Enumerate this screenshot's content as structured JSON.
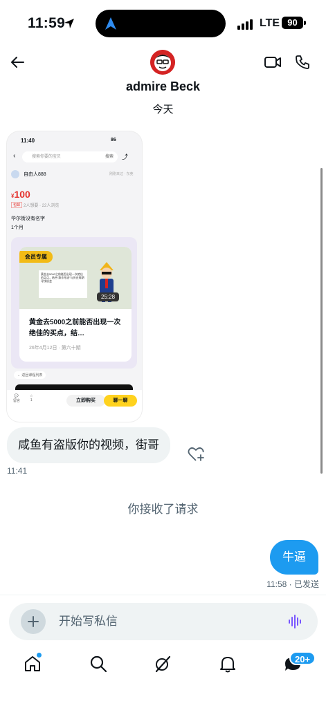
{
  "status_bar": {
    "time": "11:59",
    "network": "LTE",
    "battery": "90"
  },
  "header": {
    "contact_name": "admire Beck",
    "date_separator": "今天"
  },
  "shared_screenshot": {
    "status_time": "11:40",
    "status_battery": "86",
    "search_placeholder": "搜索你要的宝贝",
    "search_button": "搜索",
    "seller_name": "自由人888",
    "seller_right": "刚刚来过 · 东莞",
    "price_symbol": "¥",
    "price": "100",
    "tag": "包邮",
    "stats": "2人想要 · 22人浏览",
    "desc_line1": "华尔街没有名字",
    "desc_line2": "1个月",
    "badge": "会员专属",
    "poster_text": "黄金去5000之前能否出现一次绝佳的买点，结合“欺诈形态”与历史周期寻找机会",
    "duration": "25:28",
    "course_title": "黄金去5000之前能否出现一次绝佳的买点，结…",
    "course_meta": "26年4月12日 · 第六十期",
    "return_label": "← 返回课程列表",
    "bottom_msg": "留言",
    "bottom_fav": "1",
    "buy_button": "立即购买",
    "chat_button": "聊一聊"
  },
  "messages": {
    "incoming_text": "咸鱼有盗版你的视频，街哥",
    "incoming_time": "11:41",
    "system_text": "你接收了请求",
    "outgoing_text": "牛逼",
    "outgoing_status": "11:58 · 已发送"
  },
  "composer": {
    "placeholder": "开始写私信"
  },
  "tab_bar": {
    "messages_badge": "20+"
  },
  "colors": {
    "accent": "#1d9bf0",
    "bubble_in": "#eff3f4",
    "muted_text": "#536471",
    "voice_icon": "#7856ff"
  },
  "icons": [
    "location-arrow-icon",
    "navigation-icon",
    "signal-icon",
    "back-arrow-icon",
    "video-call-icon",
    "phone-icon",
    "heart-plus-icon",
    "plus-icon",
    "voice-wave-icon",
    "home-icon",
    "search-icon",
    "grok-icon",
    "bell-icon",
    "messages-icon"
  ]
}
